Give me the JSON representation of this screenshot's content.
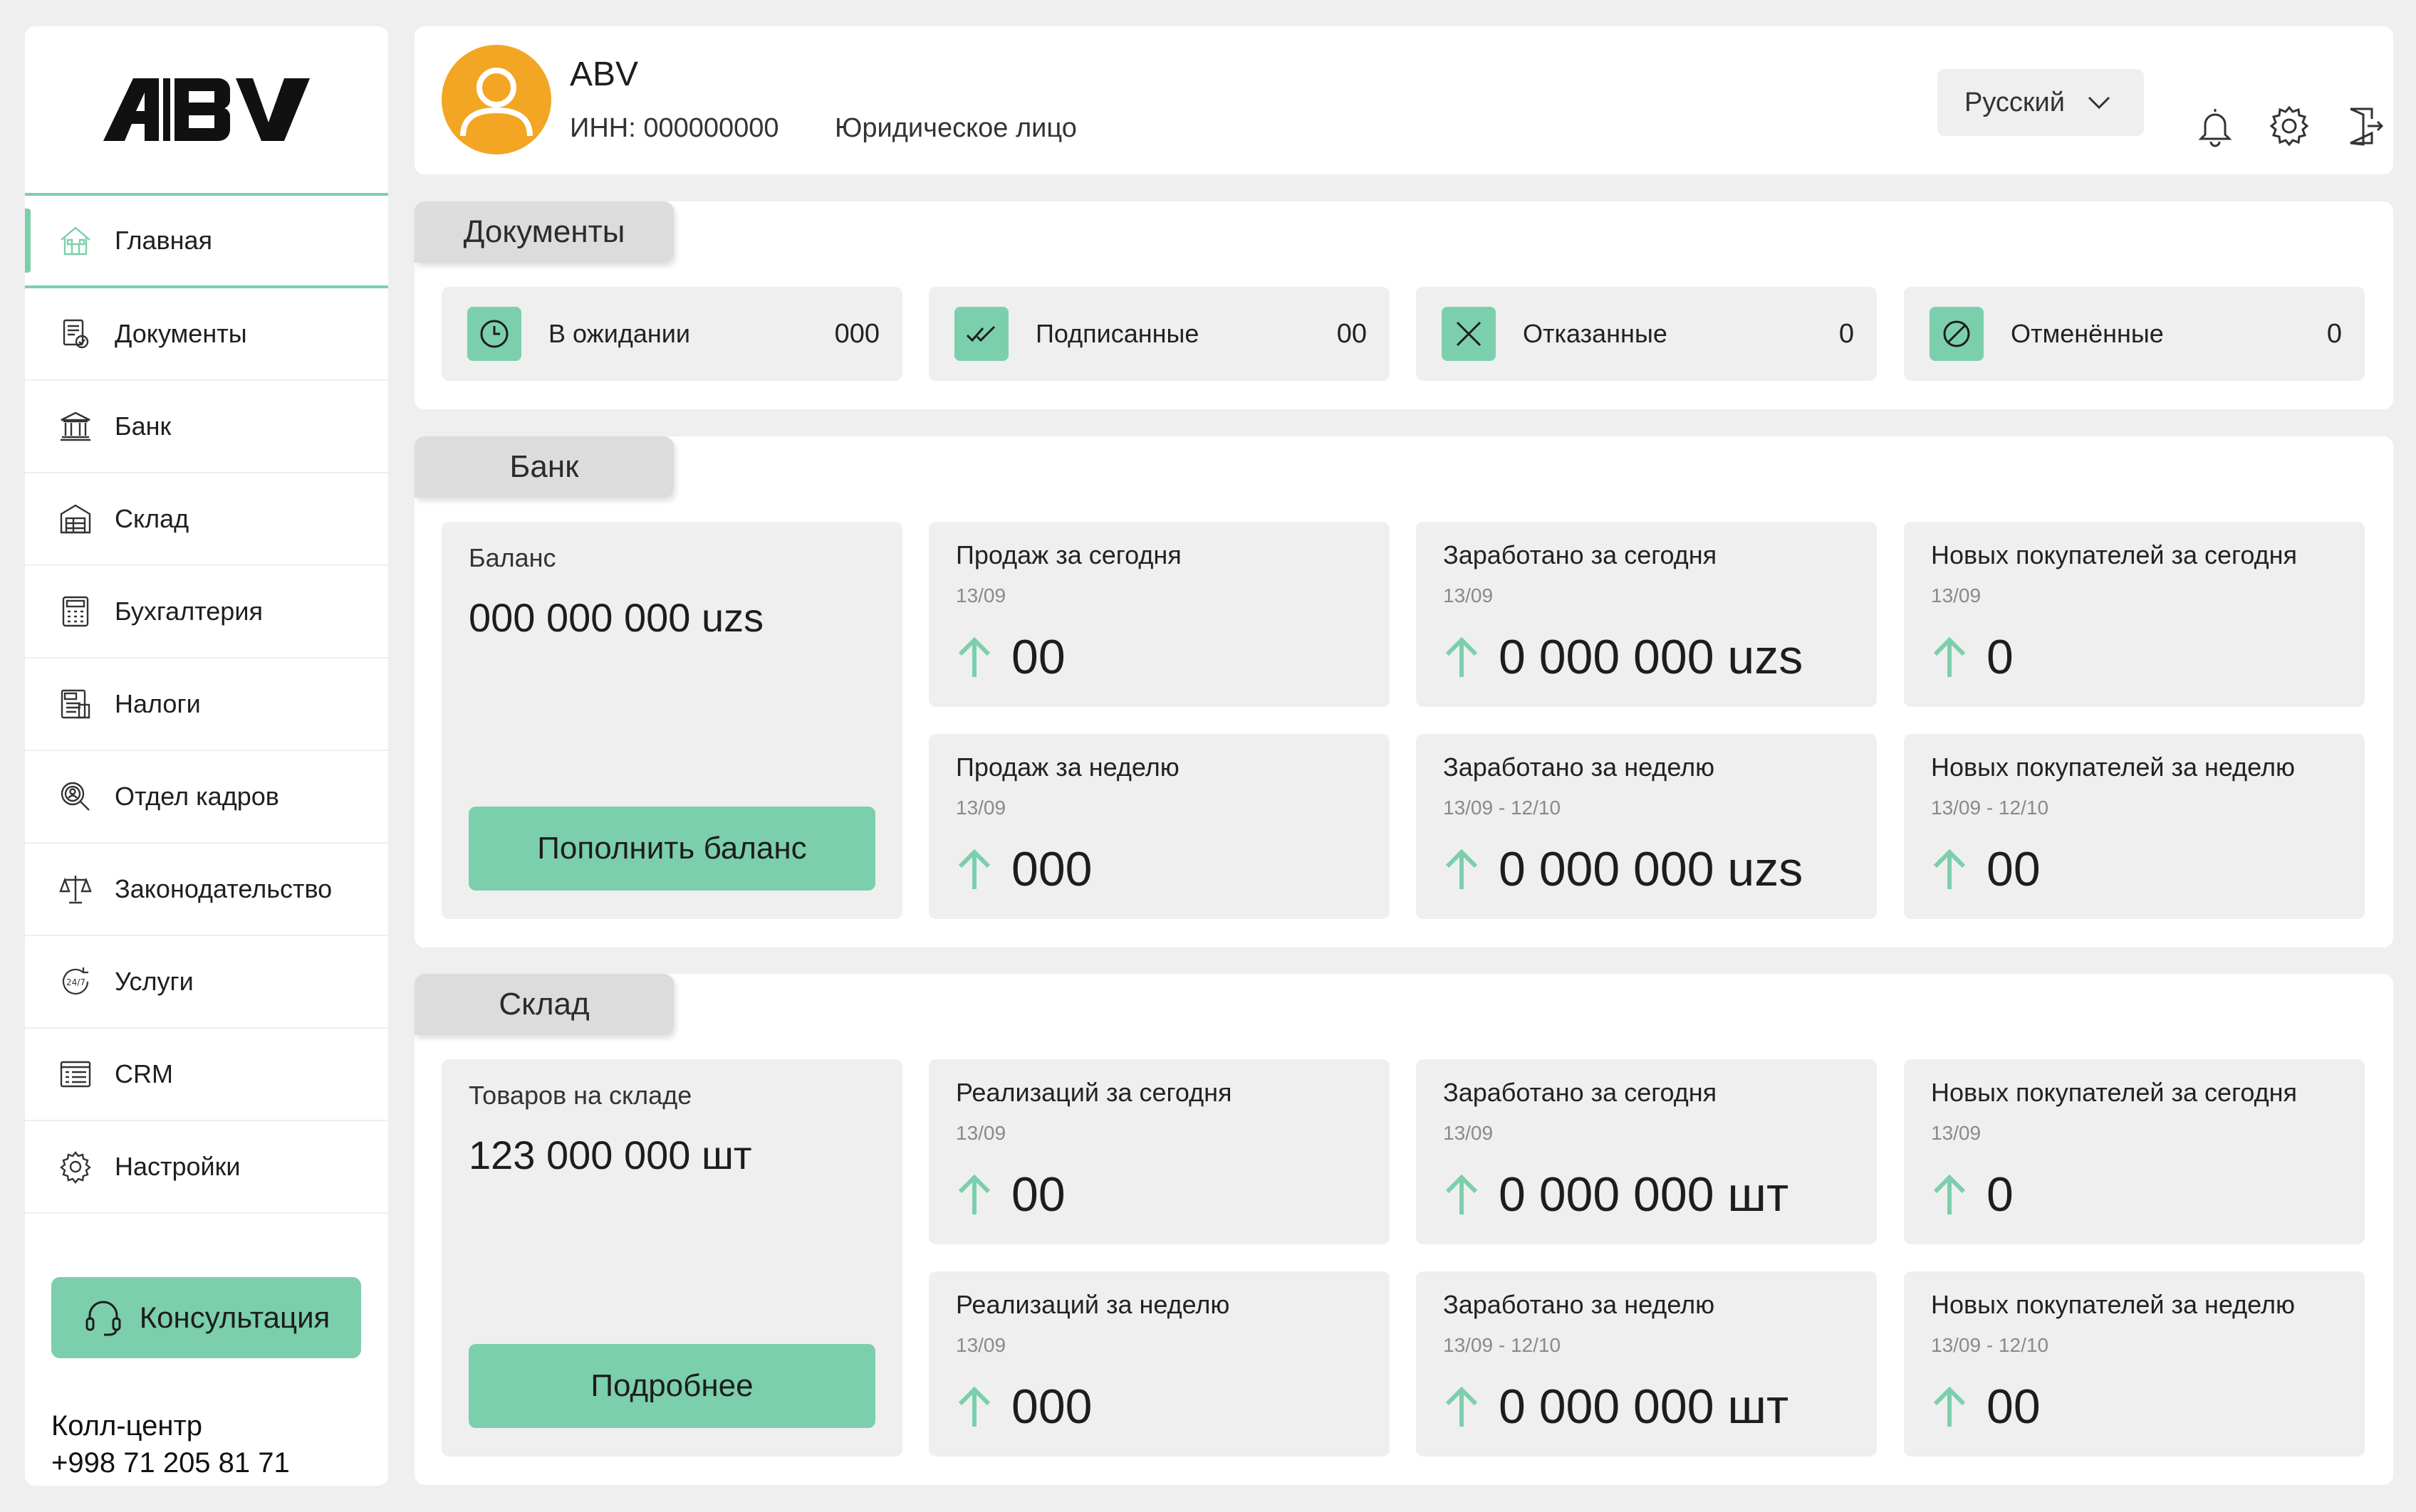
{
  "brand": {
    "logo_text": "ABV",
    "accent": "#7ccfac",
    "avatar_color": "#f3a624"
  },
  "sidebar": {
    "items": [
      {
        "label": "Главная",
        "icon": "home-icon",
        "active": true
      },
      {
        "label": "Документы",
        "icon": "documents-icon"
      },
      {
        "label": "Банк",
        "icon": "bank-icon"
      },
      {
        "label": "Склад",
        "icon": "warehouse-icon"
      },
      {
        "label": "Бухгалтерия",
        "icon": "calculator-icon"
      },
      {
        "label": "Налоги",
        "icon": "tax-icon"
      },
      {
        "label": "Отдел кадров",
        "icon": "hr-search-icon"
      },
      {
        "label": "Законодательство",
        "icon": "scales-icon"
      },
      {
        "label": "Услуги",
        "icon": "services-24-7-icon"
      },
      {
        "label": "CRM",
        "icon": "crm-icon"
      },
      {
        "label": "Настройки",
        "icon": "settings-icon"
      }
    ],
    "consult_label": "Консультация",
    "callcenter_label": "Колл-центр",
    "callcenter_phone": "+998 71 205 81 71"
  },
  "header": {
    "company_name": "ABV",
    "inn": "ИНН: 000000000",
    "entity_type": "Юридическое лицо",
    "language": "Русский"
  },
  "documents": {
    "tab": "Документы",
    "cards": [
      {
        "label": "В ожидании",
        "count": "000",
        "icon": "clock-icon"
      },
      {
        "label": "Подписанные",
        "count": "00",
        "icon": "double-check-icon"
      },
      {
        "label": "Отказанные",
        "count": "0",
        "icon": "cross-icon"
      },
      {
        "label": "Отменённые",
        "count": "0",
        "icon": "cancel-icon"
      }
    ]
  },
  "bank": {
    "tab": "Банк",
    "balance_label": "Баланс",
    "balance_value": "000 000 000 uzs",
    "button": "Пополнить баланс",
    "stats": [
      {
        "title": "Продаж за сегодня",
        "date": "13/09",
        "value": "00"
      },
      {
        "title": "Заработано за сегодня",
        "date": "13/09",
        "value": "0 000 000 uzs"
      },
      {
        "title": "Новых покупателей за сегодня",
        "date": "13/09",
        "value": "0"
      },
      {
        "title": "Продаж за неделю",
        "date": "13/09",
        "value": "000"
      },
      {
        "title": "Заработано за неделю",
        "date": "13/09 - 12/10",
        "value": "0 000 000 uzs"
      },
      {
        "title": "Новых покупателей за неделю",
        "date": "13/09 - 12/10",
        "value": "00"
      }
    ]
  },
  "warehouse": {
    "tab": "Склад",
    "stock_label": "Товаров на складе",
    "stock_value": "123 000 000 шт",
    "button": "Подробнее",
    "stats": [
      {
        "title": "Реализаций за сегодня",
        "date": "13/09",
        "value": "00"
      },
      {
        "title": "Заработано за сегодня",
        "date": "13/09",
        "value": "0 000 000 шт"
      },
      {
        "title": "Новых покупателей за сегодня",
        "date": "13/09",
        "value": "0"
      },
      {
        "title": "Реализаций за неделю",
        "date": "13/09",
        "value": "000"
      },
      {
        "title": "Заработано за неделю",
        "date": "13/09 - 12/10",
        "value": "0 000 000 шт"
      },
      {
        "title": "Новых покупателей за неделю",
        "date": "13/09 - 12/10",
        "value": "00"
      }
    ]
  }
}
